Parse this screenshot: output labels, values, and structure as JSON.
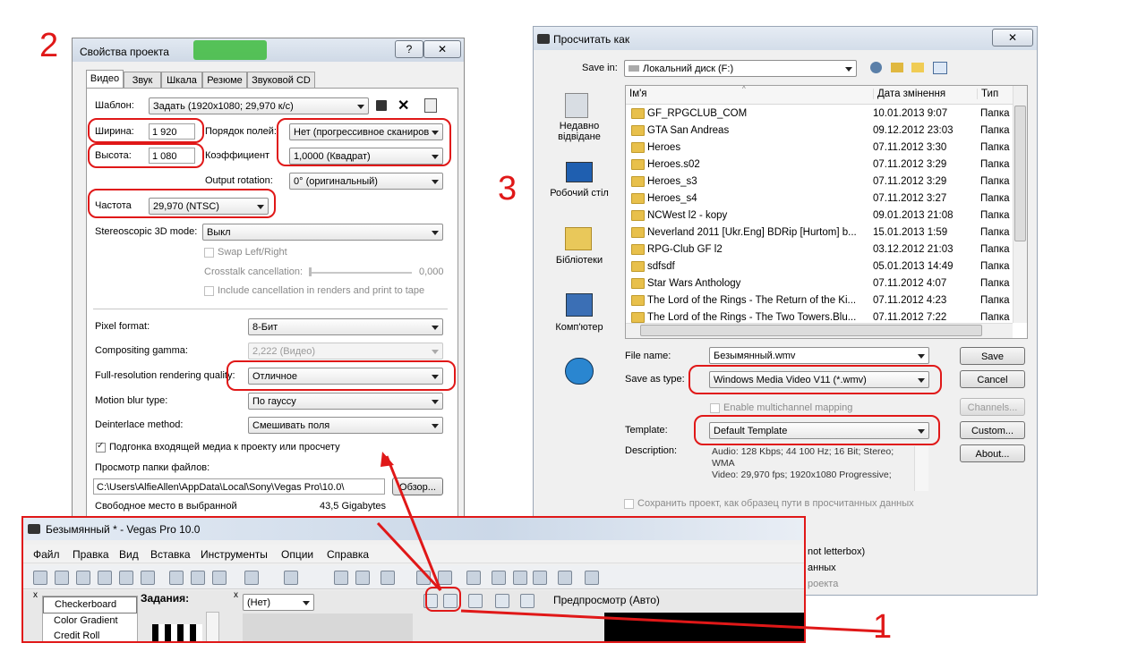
{
  "annotations": {
    "n1": "1",
    "n2": "2",
    "n3": "3"
  },
  "props": {
    "title": "Свойства проекта",
    "help": "?",
    "close": "✕",
    "tabs": [
      "Видео",
      "Звук",
      "Шкала",
      "Резюме",
      "Звуковой CD"
    ],
    "template_label": "Шаблон:",
    "template_value": "Задать (1920x1080; 29,970 к/с)",
    "width_label": "Ширина:",
    "width_value": "1 920",
    "field_order_label": "Порядок полей:",
    "field_order_value": "Нет (прогрессивное сканиров",
    "height_label": "Высота:",
    "height_value": "1 080",
    "aspect_label": "Коэффициент",
    "aspect_value": "1,0000 (Квадрат)",
    "rotation_label": "Output rotation:",
    "rotation_value": "0° (оригинальный)",
    "freq_label": "Частота",
    "freq_value": "29,970 (NTSC)",
    "stereo_label": "Stereoscopic 3D mode:",
    "stereo_value": "Выкл",
    "swap_label": "Swap Left/Right",
    "crosstalk_label": "Crosstalk cancellation:",
    "crosstalk_value": "0,000",
    "include_label": "Include cancellation in renders and print to tape",
    "pixel_label": "Pixel format:",
    "pixel_value": "8-Бит",
    "gamma_label": "Compositing gamma:",
    "gamma_value": "2,222 (Видео)",
    "quality_label": "Full-resolution rendering quality:",
    "quality_value": "Отличное",
    "blur_label": "Motion blur type:",
    "blur_value": "По гауссу",
    "deint_label": "Deinterlace method:",
    "deint_value": "Смешивать поля",
    "adapt_label": "Подгонка входящей медиа к проекту или просчету",
    "folder_label": "Просмотр папки файлов:",
    "folder_value": "C:\\Users\\AlfieAllen\\AppData\\Local\\Sony\\Vegas Pro\\10.0\\",
    "browse_label": "Обзор...",
    "free_label": "Свободное место в выбранной",
    "free_value": "43,5 Gigabytes"
  },
  "save": {
    "title": "Просчитать как",
    "close": "✕",
    "save_in_label": "Save in:",
    "save_in_value": "Локальний диск (F:)",
    "places": [
      "Недавно відвідане",
      "Робочий стіл",
      "Бібліотеки",
      "Комп'ютер"
    ],
    "col_name": "Ім'я",
    "col_date": "Дата змінення",
    "col_type": "Тип",
    "files": [
      {
        "name": "GF_RPGCLUB_COM",
        "date": "10.01.2013 9:07",
        "type": "Папка"
      },
      {
        "name": "GTA San Andreas",
        "date": "09.12.2012 23:03",
        "type": "Папка"
      },
      {
        "name": "Heroes",
        "date": "07.11.2012 3:30",
        "type": "Папка"
      },
      {
        "name": "Heroes.s02",
        "date": "07.11.2012 3:29",
        "type": "Папка"
      },
      {
        "name": "Heroes_s3",
        "date": "07.11.2012 3:29",
        "type": "Папка"
      },
      {
        "name": "Heroes_s4",
        "date": "07.11.2012 3:27",
        "type": "Папка"
      },
      {
        "name": "NCWest l2 - kopy",
        "date": "09.01.2013 21:08",
        "type": "Папка"
      },
      {
        "name": "Neverland 2011 [Ukr.Eng] BDRip [Hurtom] b...",
        "date": "15.01.2013 1:59",
        "type": "Папка"
      },
      {
        "name": "RPG-Club GF l2",
        "date": "03.12.2012 21:03",
        "type": "Папка"
      },
      {
        "name": "sdfsdf",
        "date": "05.01.2013 14:49",
        "type": "Папка"
      },
      {
        "name": "Star Wars Anthology",
        "date": "07.11.2012 4:07",
        "type": "Папка"
      },
      {
        "name": "The Lord of the Rings - The Return of the Ki...",
        "date": "07.11.2012 4:23",
        "type": "Папка"
      },
      {
        "name": "The Lord of the Rings - The Two Towers.Blu...",
        "date": "07.11.2012 7:22",
        "type": "Папка"
      }
    ],
    "filename_label": "File name:",
    "filename_value": "Безымянный.wmv",
    "type_label": "Save as type:",
    "type_value": "Windows Media Video V11 (*.wmv)",
    "multichannel_label": "Enable multichannel mapping",
    "template_label": "Template:",
    "template_value": "Default Template",
    "desc_label": "Description:",
    "desc_line1": "Audio: 128 Kbps; 44 100 Hz; 16 Bit; Stereo;",
    "desc_line2": "WMA",
    "desc_line3": "Video: 29,970 fps; 1920x1080 Progressive;",
    "save_btn": "Save",
    "cancel_btn": "Cancel",
    "channels_btn": "Channels...",
    "custom_btn": "Custom...",
    "about_btn": "About...",
    "save_path_label": "Сохранить проект, как образец пути в просчитанных данных",
    "partial1": "not letterbox)",
    "partial2": "анных",
    "partial3": "роекта"
  },
  "vegas": {
    "title": "Безымянный * - Vegas Pro 10.0",
    "menu": [
      "Файл",
      "Правка",
      "Вид",
      "Вставка",
      "Инструменты",
      "Опции",
      "Справка"
    ],
    "fx_items": [
      "Checkerboard",
      "Color Gradient",
      "Credit Roll"
    ],
    "tasks_label": "Задания:",
    "combo_value": "(Нет)",
    "preview_label": "Предпросмотр (Авто)"
  }
}
